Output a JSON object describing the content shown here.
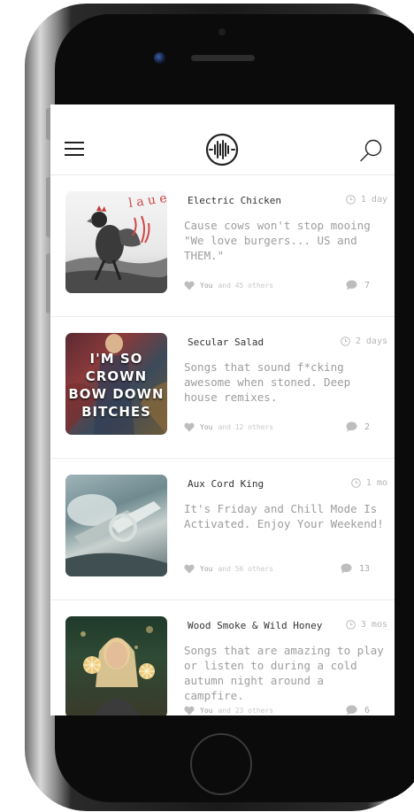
{
  "header": {
    "menu_icon": "hamburger-menu-icon",
    "logo_icon": "soundwave-logo-icon",
    "search_icon": "search-icon"
  },
  "playlists": [
    {
      "title": "Electric Chicken",
      "time": "1 day",
      "description": "Cause cows won't stop mooing \"We love burgers... US and THEM.\"",
      "likes_you": "You",
      "likes_others": "and 45 others",
      "comments": "7",
      "thumb_icon": "rooster-collage-image"
    },
    {
      "title": "Secular Salad",
      "time": "2 days",
      "description": "Songs that sound f*cking awesome when stoned. Deep house remixes.",
      "likes_you": "You",
      "likes_others": "and 12 others",
      "comments": "2",
      "thumb_icon": "crown-poster-image",
      "thumb_text": [
        "I'M SO",
        "CROWN",
        "BOW DOWN",
        "BITCHES"
      ]
    },
    {
      "title": "Aux Cord King",
      "time": "1 mo",
      "description": "It's Friday and Chill Mode Is Activated. Enjoy Your Weekend!",
      "likes_you": "You",
      "likes_others": "and 56 others",
      "comments": "13",
      "thumb_icon": "car-interior-image"
    },
    {
      "title": "Wood Smoke & Wild Honey",
      "time": "3 mos",
      "description": "Songs that are amazing to play or listen to during a cold autumn night around a campfire.",
      "likes_you": "You",
      "likes_others": "and 23 others",
      "comments": "6",
      "thumb_icon": "sparkler-girl-image"
    }
  ],
  "colors": {
    "text_dark": "#333333",
    "text_muted": "#9d9d9d",
    "divider": "#ededed",
    "icon_gray": "#bdbdbd"
  }
}
